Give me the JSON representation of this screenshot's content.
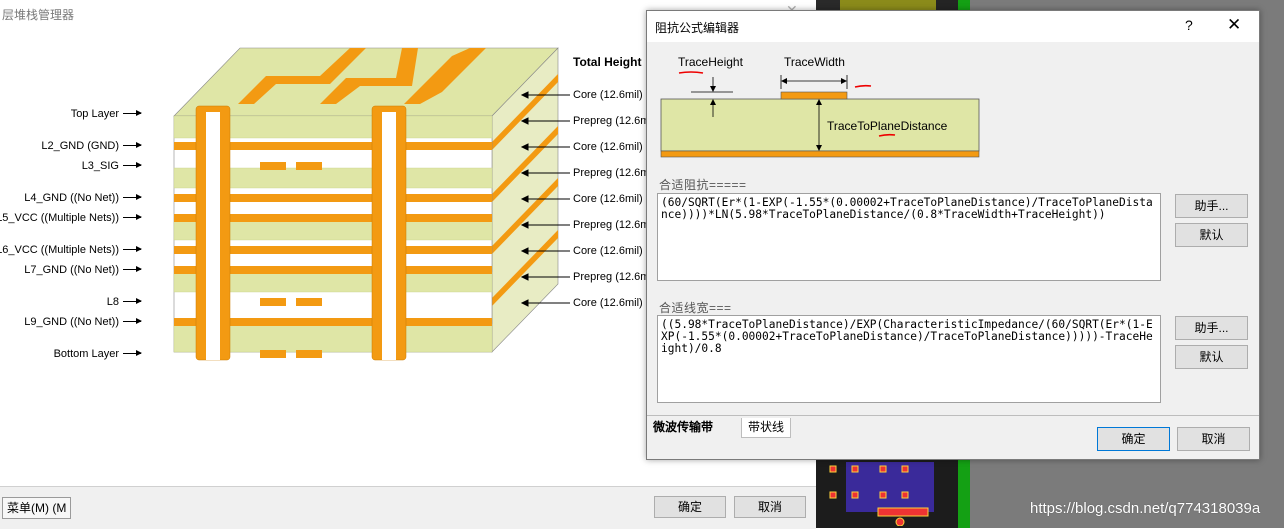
{
  "background_window": {
    "title": "层堆栈管理器",
    "total_height_label": "Total Height",
    "layers": [
      {
        "name": "Top Layer"
      },
      {
        "name": "L2_GND (GND)"
      },
      {
        "name": "L3_SIG"
      },
      {
        "name": "L4_GND ((No Net))"
      },
      {
        "name": "L5_VCC ((Multiple Nets))"
      },
      {
        "name": "L6_VCC ((Multiple Nets))"
      },
      {
        "name": "L7_GND ((No Net))"
      },
      {
        "name": "L8"
      },
      {
        "name": "L9_GND ((No Net))"
      },
      {
        "name": "Bottom Layer"
      }
    ],
    "dielectrics": [
      {
        "label": "Core (12.6mil)"
      },
      {
        "label": "Prepreg (12.6m"
      },
      {
        "label": "Core (12.6mil)"
      },
      {
        "label": "Prepreg (12.6m"
      },
      {
        "label": "Core (12.6mil)"
      },
      {
        "label": "Prepreg (12.6m"
      },
      {
        "label": "Core (12.6mil)"
      },
      {
        "label": "Prepreg (12.6m"
      },
      {
        "label": "Core (12.6mil)"
      }
    ],
    "menu_label": "菜单(M) (M",
    "ok_label": "确定",
    "cancel_label": "取消",
    "colors": {
      "copper": "#f39a12",
      "dielectric": "#dfe6a6",
      "prepreg": "#f4f7d8"
    }
  },
  "dialog": {
    "title": "阻抗公式编辑器",
    "help_glyph": "?",
    "close_glyph": "✕",
    "diagram": {
      "trace_height": "TraceHeight",
      "trace_width": "TraceWidth",
      "trace_to_plane": "TraceToPlaneDistance"
    },
    "impedance_section": "合适阻抗=====",
    "impedance_formula": "(60/SQRT(Er*(1-EXP(-1.55*(0.00002+TraceToPlaneDistance)/TraceToPlaneDistance))))*LN(5.98*TraceToPlaneDistance/(0.8*TraceWidth+TraceHeight))",
    "width_section": "合适线宽===",
    "width_formula": "((5.98*TraceToPlaneDistance)/EXP(CharacteristicImpedance/(60/SQRT(Er*(1-EXP(-1.55*(0.00002+TraceToPlaneDistance)/TraceToPlaneDistance)))))-TraceHeight)/0.8",
    "helper_label": "助手...",
    "default_label": "默认",
    "tabs": [
      {
        "label": "微波传输带"
      },
      {
        "label": "带状线"
      }
    ],
    "ok_label": "确定",
    "cancel_label": "取消"
  },
  "watermark": "https://blog.csdn.net/q774318039a"
}
